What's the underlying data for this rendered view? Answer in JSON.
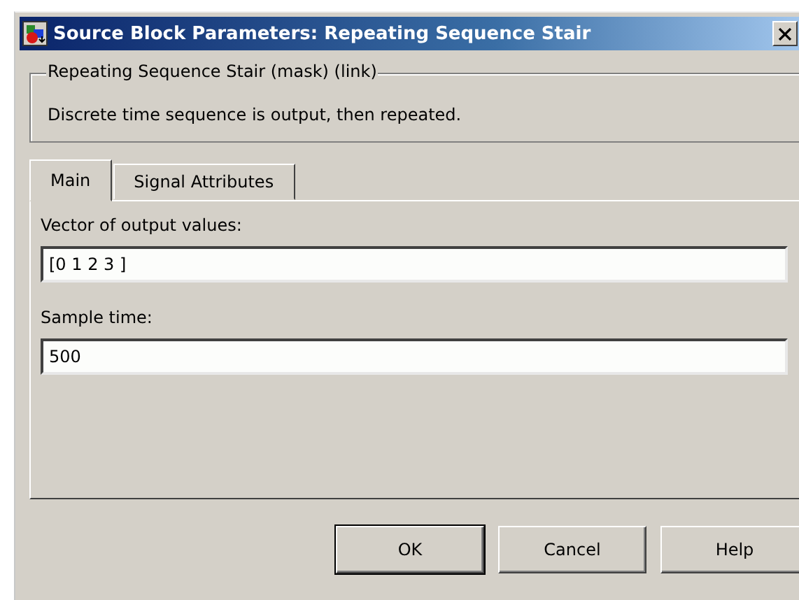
{
  "window": {
    "title": "Source Block Parameters: Repeating Sequence Stair"
  },
  "description": {
    "heading": "Repeating Sequence Stair (mask) (link)",
    "text": "Discrete time sequence is output, then repeated."
  },
  "tabs": [
    {
      "label": "Main",
      "selected": true
    },
    {
      "label": "Signal Attributes",
      "selected": false
    }
  ],
  "fields": [
    {
      "label": "Vector of output values:",
      "value": "[0 1 2 3 ]"
    },
    {
      "label": "Sample time:",
      "value": "500"
    }
  ],
  "buttons": [
    {
      "label": "OK",
      "default": true
    },
    {
      "label": "Cancel",
      "default": false
    },
    {
      "label": "Help",
      "default": false
    }
  ]
}
